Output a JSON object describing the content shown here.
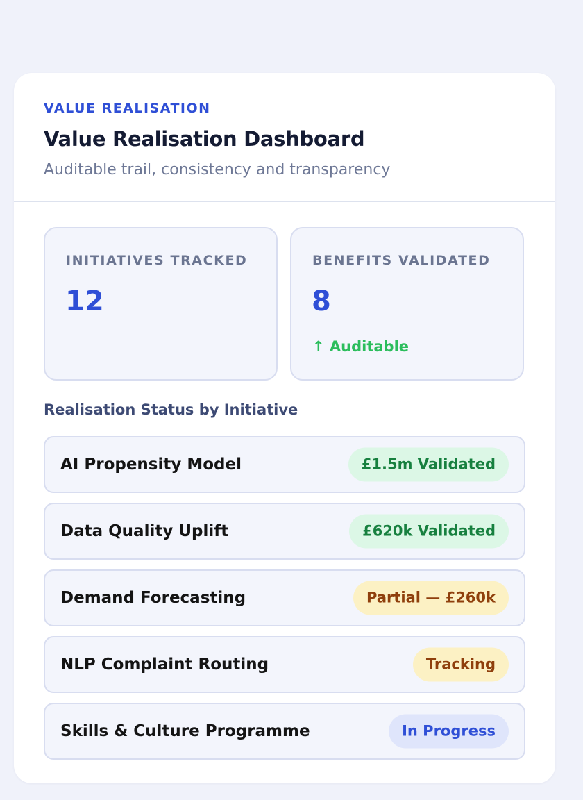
{
  "header": {
    "eyebrow": "VALUE REALISATION",
    "title": "Value Realisation Dashboard",
    "subtitle": "Auditable trail, consistency and transparency"
  },
  "stats": [
    {
      "label": "INITIATIVES TRACKED",
      "value": "12",
      "note": ""
    },
    {
      "label": "BENEFITS VALIDATED",
      "value": "8",
      "note": "↑ Auditable"
    }
  ],
  "section_title": "Realisation Status by Initiative",
  "initiatives": [
    {
      "name": "AI Propensity Model",
      "status": "£1.5m Validated",
      "status_type": "validated"
    },
    {
      "name": "Data Quality Uplift",
      "status": "£620k Validated",
      "status_type": "validated"
    },
    {
      "name": "Demand Forecasting",
      "status": "Partial — £260k",
      "status_type": "partial"
    },
    {
      "name": "NLP Complaint Routing",
      "status": "Tracking",
      "status_type": "tracking"
    },
    {
      "name": "Skills & Culture Programme",
      "status": "In Progress",
      "status_type": "progress"
    }
  ],
  "colors": {
    "accent": "#2f4fd6",
    "positive": "#2bbd5c",
    "validated_bg": "#dcf7e6",
    "validated_text": "#17803f",
    "warning_bg": "#fcf1c4",
    "warning_text": "#8f3f0c",
    "progress_bg": "#dfe5fb"
  }
}
